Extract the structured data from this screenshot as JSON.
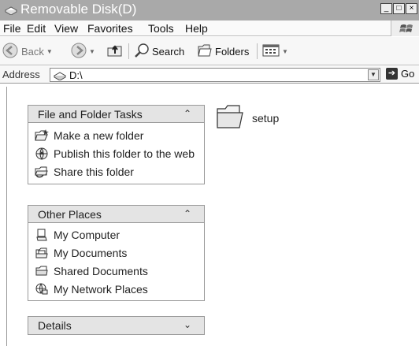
{
  "window": {
    "title": "Removable Disk(D)",
    "minimize": "_",
    "maximize": "□",
    "close": "×"
  },
  "menu": {
    "file": "File",
    "edit": "Edit",
    "view": "View",
    "favorites": "Favorites",
    "tools": "Tools",
    "help": "Help"
  },
  "toolbar": {
    "back": "Back",
    "search": "Search",
    "folders": "Folders"
  },
  "address": {
    "label": "Address",
    "value": "D:\\",
    "go": "Go"
  },
  "tasks_panel": {
    "title": "File and Folder Tasks",
    "items": [
      {
        "label": "Make a new folder",
        "icon": "new-folder-icon"
      },
      {
        "label": "Publish this folder to the web",
        "icon": "publish-web-icon"
      },
      {
        "label": "Share this folder",
        "icon": "share-folder-icon"
      }
    ]
  },
  "places_panel": {
    "title": "Other Places",
    "items": [
      {
        "label": "My Computer",
        "icon": "my-computer-icon"
      },
      {
        "label": "My Documents",
        "icon": "my-documents-icon"
      },
      {
        "label": "Shared Documents",
        "icon": "shared-documents-icon"
      },
      {
        "label": "My Network Places",
        "icon": "network-places-icon"
      }
    ]
  },
  "details_panel": {
    "title": "Details"
  },
  "files": [
    {
      "name": "setup",
      "icon": "folder-icon"
    }
  ]
}
